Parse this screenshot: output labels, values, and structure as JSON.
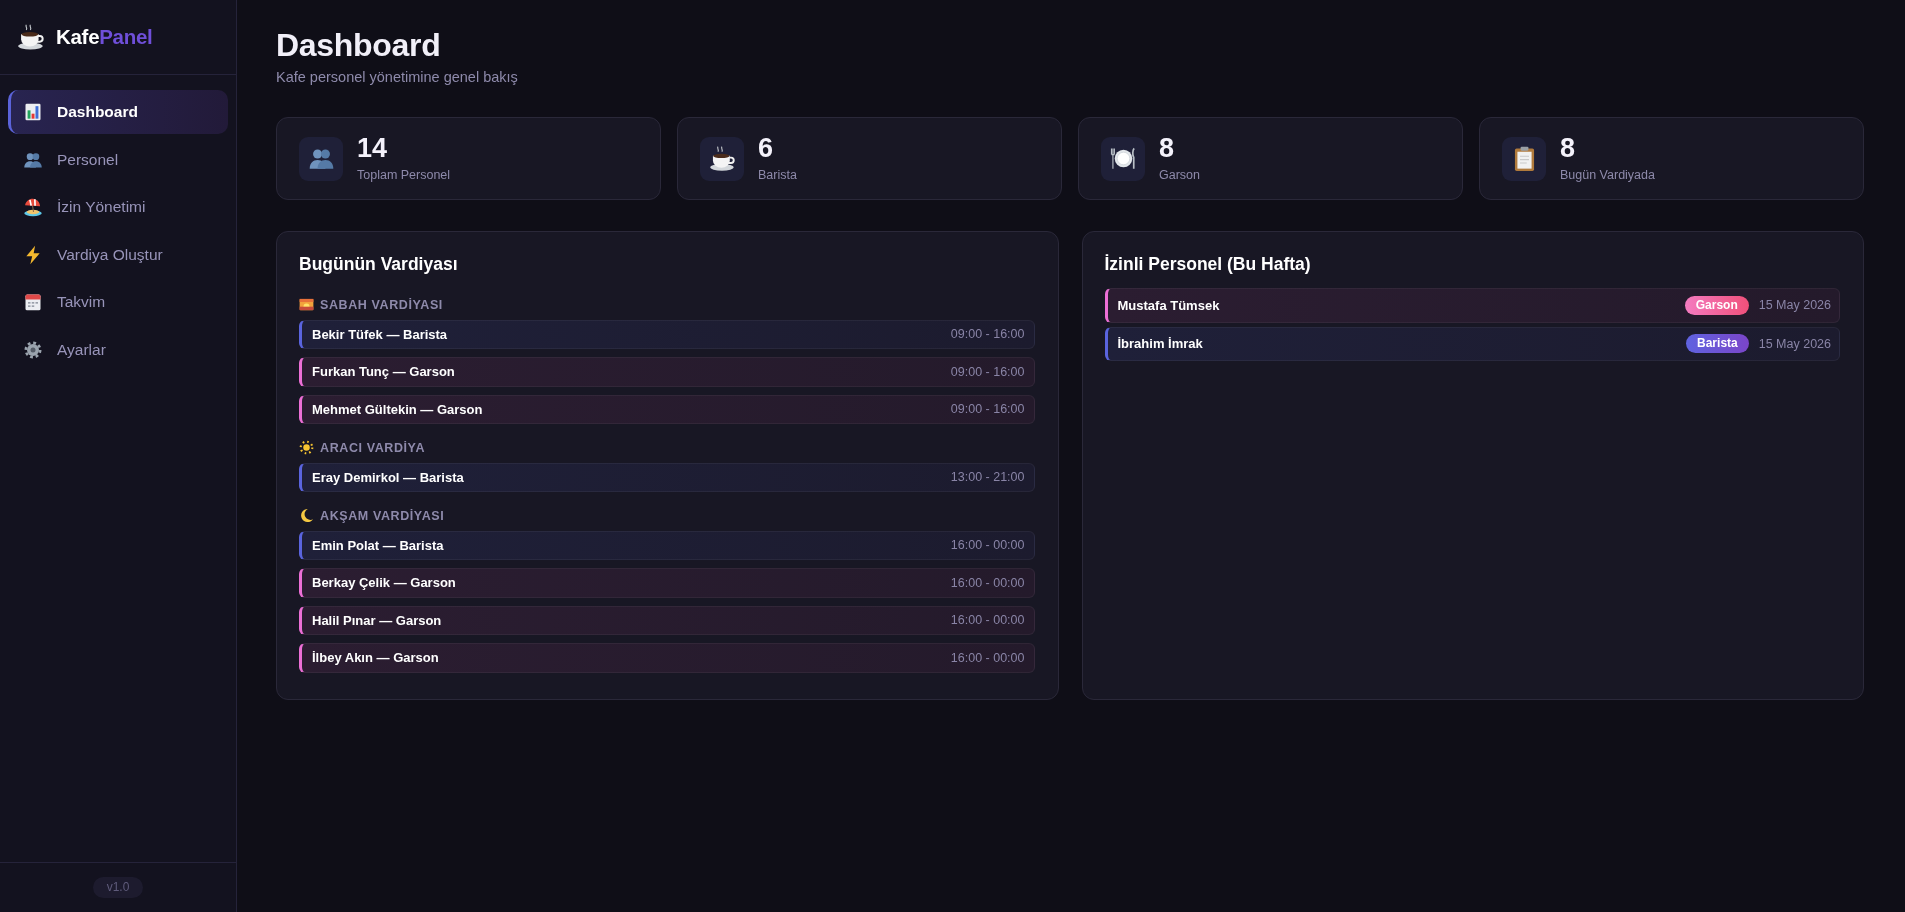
{
  "sidebar": {
    "brand": {
      "main": "Kafe",
      "accent": "Panel"
    },
    "items": [
      {
        "label": "Dashboard",
        "selected": true
      },
      {
        "label": "Personel",
        "selected": false
      },
      {
        "label": "İzin Yönetimi",
        "selected": false
      },
      {
        "label": "Vardiya Oluştur",
        "selected": false
      },
      {
        "label": "Takvim",
        "selected": false
      },
      {
        "label": "Ayarlar",
        "selected": false
      }
    ],
    "version": "v1.0"
  },
  "header": {
    "title": "Dashboard",
    "subtitle": "Kafe personel yönetimine genel bakış"
  },
  "stats": [
    {
      "value": "14",
      "label": "Toplam Personel"
    },
    {
      "value": "6",
      "label": "Barista"
    },
    {
      "value": "8",
      "label": "Garson"
    },
    {
      "value": "8",
      "label": "Bugün Vardiyada"
    }
  ],
  "todays_shifts": {
    "title": "Bugünün Vardiyası",
    "groups": [
      {
        "title": "SABAH VARDİYASI",
        "rows": [
          {
            "label": "Bekir Tüfek — Barista",
            "time": "09:00 - 16:00",
            "kind": "barista"
          },
          {
            "label": "Furkan Tunç — Garson",
            "time": "09:00 - 16:00",
            "kind": "garson"
          },
          {
            "label": "Mehmet Gültekin — Garson",
            "time": "09:00 - 16:00",
            "kind": "garson"
          }
        ]
      },
      {
        "title": "ARACI VARDİYA",
        "rows": [
          {
            "label": "Eray Demirkol — Barista",
            "time": "13:00 - 21:00",
            "kind": "barista"
          }
        ]
      },
      {
        "title": "AKŞAM VARDİYASI",
        "rows": [
          {
            "label": "Emin Polat — Barista",
            "time": "16:00 - 00:00",
            "kind": "barista"
          },
          {
            "label": "Berkay Çelik — Garson",
            "time": "16:00 - 00:00",
            "kind": "garson"
          },
          {
            "label": "Halil Pınar — Garson",
            "time": "16:00 - 00:00",
            "kind": "garson"
          },
          {
            "label": "İlbey Akın — Garson",
            "time": "16:00 - 00:00",
            "kind": "garson"
          }
        ]
      }
    ]
  },
  "on_leave": {
    "title": "İzinli Personel (Bu Hafta)",
    "rows": [
      {
        "name": "Mustafa Tümsek",
        "role": "Garson",
        "date": "15 May 2026",
        "kind": "garson"
      },
      {
        "name": "İbrahim İmrak",
        "role": "Barista",
        "date": "15 May 2026",
        "kind": "barista"
      }
    ]
  }
}
